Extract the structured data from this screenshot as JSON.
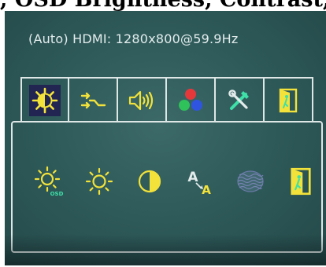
{
  "caption": ", OSD Brightness, Contrast, Shar",
  "osd": {
    "input_info": "(Auto) HDMI: 1280x800@59.9Hz",
    "tabs": [
      {
        "icon": "brightness-contrast-icon",
        "active": true
      },
      {
        "icon": "input-source-icon",
        "active": false
      },
      {
        "icon": "volume-icon",
        "active": false
      },
      {
        "icon": "color-rgb-icon",
        "active": false
      },
      {
        "icon": "tools-icon",
        "active": false
      },
      {
        "icon": "exit-icon",
        "active": false
      }
    ],
    "items": [
      {
        "icon": "osd-brightness-icon",
        "sublabel": "OSD"
      },
      {
        "icon": "brightness-icon"
      },
      {
        "icon": "contrast-icon"
      },
      {
        "icon": "sharpness-icon",
        "letters": [
          "A",
          "A"
        ]
      },
      {
        "icon": "noise-reduction-icon"
      },
      {
        "icon": "exit-icon"
      }
    ],
    "colors": {
      "icon_yellow": "#f2e23a",
      "icon_green": "#3ee0a8",
      "frame_line": "#dfe7e6",
      "active_tab": "#222452",
      "screen_bg": "#2f5b5b"
    }
  }
}
